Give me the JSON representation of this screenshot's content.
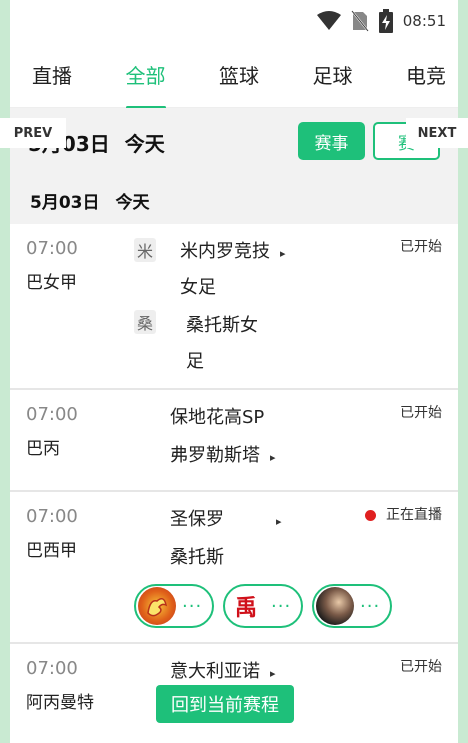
{
  "status_bar": {
    "time": "08:51",
    "icons": [
      "wifi-icon",
      "no-sim-icon",
      "battery-charging-icon"
    ]
  },
  "tabs": [
    {
      "label": "直播",
      "active": false
    },
    {
      "label": "全部",
      "active": true
    },
    {
      "label": "篮球",
      "active": false
    },
    {
      "label": "足球",
      "active": false
    },
    {
      "label": "电竞",
      "active": false
    }
  ],
  "date_bar": {
    "prev_label": "PREV",
    "next_label": "NEXT",
    "date_text": "5月03日",
    "today_text": "今天",
    "events_button": "赛事",
    "second_button": "赛"
  },
  "section": {
    "date": "5月03日",
    "day": "今天"
  },
  "matches": [
    {
      "time": "07:00",
      "league": "巴女甲",
      "status": "已开始",
      "home_logo": "米",
      "home": "米内罗竞技",
      "home_line2": "女足",
      "away_logo": "桑",
      "away": "桑托斯女",
      "away_line2": "足"
    },
    {
      "time": "07:00",
      "league": "巴丙",
      "status": "已开始",
      "home": "保地花高SP",
      "away": "弗罗勒斯塔"
    },
    {
      "time": "07:00",
      "league": "巴西甲",
      "status": "正在直播",
      "home": "圣保罗",
      "away": "桑托斯",
      "anchors": [
        {
          "avatar": "dragon-avatar",
          "dots": "···"
        },
        {
          "avatar": "禹",
          "dots": "···"
        },
        {
          "avatar": "girl-avatar",
          "dots": "···"
        }
      ]
    },
    {
      "time": "07:00",
      "league": "阿丙曼特",
      "status": "已开始",
      "home": "意大利亚诺"
    }
  ],
  "back_button": "回到当前赛程",
  "colors": {
    "accent": "#1ec07a",
    "live": "#e02020",
    "frame": "#c9ead2"
  }
}
